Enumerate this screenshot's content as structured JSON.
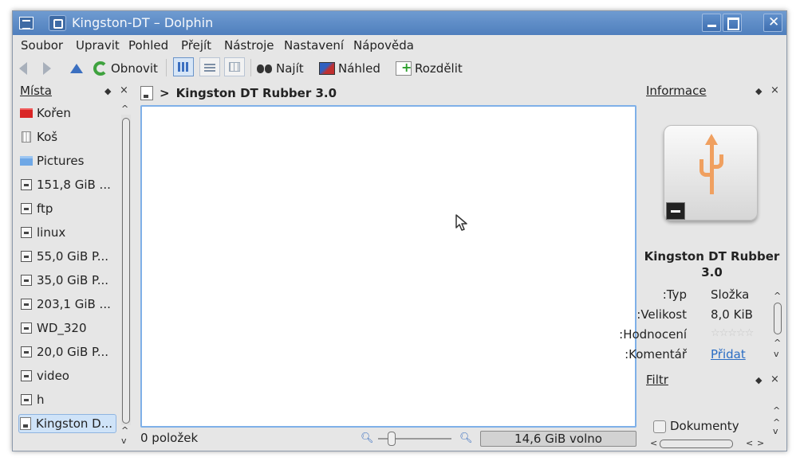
{
  "window": {
    "title": "Kingston-DT – Dolphin",
    "close_glyph": "✕"
  },
  "menu": [
    "Soubor",
    "Upravit",
    "Pohled",
    "Přejít",
    "Nástroje",
    "Nastavení",
    "Nápověda"
  ],
  "toolbar": {
    "refresh_label": "Obnovit",
    "find_label": "Najít",
    "preview_label": "Náhled",
    "split_label": "Rozdělit"
  },
  "places": {
    "title": "Místa",
    "items": [
      {
        "label": "Kořen",
        "icon": "red-folder-icon"
      },
      {
        "label": "Koš",
        "icon": "trash-icon"
      },
      {
        "label": "Pictures",
        "icon": "folder-icon"
      },
      {
        "label": "151,8 GiB ...",
        "icon": "drive-icon"
      },
      {
        "label": "ftp",
        "icon": "drive-icon"
      },
      {
        "label": "linux",
        "icon": "drive-icon"
      },
      {
        "label": "55,0 GiB P...",
        "icon": "drive-icon"
      },
      {
        "label": "35,0 GiB P...",
        "icon": "drive-icon"
      },
      {
        "label": "203,1 GiB ...",
        "icon": "drive-icon"
      },
      {
        "label": "WD_320",
        "icon": "drive-icon"
      },
      {
        "label": "20,0 GiB P...",
        "icon": "drive-icon"
      },
      {
        "label": "video",
        "icon": "drive-icon"
      },
      {
        "label": "h",
        "icon": "drive-icon"
      },
      {
        "label": "Kingston D...",
        "icon": "usb-drive-icon"
      }
    ]
  },
  "breadcrumb": {
    "separator": ">",
    "current": "Kingston DT Rubber 3.0"
  },
  "status": {
    "items": "0 položek",
    "free_space": "14,6 GiB volno"
  },
  "info_panel": {
    "title": "Informace",
    "name": "Kingston DT Rubber 3.0",
    "rows": [
      {
        "key": "Typ:",
        "value": "Složka"
      },
      {
        "key": "Velikost:",
        "value": "8,0 KiB"
      },
      {
        "key": "Hodnocení:",
        "value": "☆☆☆☆☆"
      },
      {
        "key": "Komentář:",
        "value": "Přidat"
      }
    ]
  },
  "filter_panel": {
    "title": "Filtr",
    "option": "Dokumenty"
  },
  "colors": {
    "titlebar": "#5a88c6",
    "selection": "#cfe3f8",
    "link": "#2a6dc4",
    "usb_symbol": "#f0a060"
  }
}
